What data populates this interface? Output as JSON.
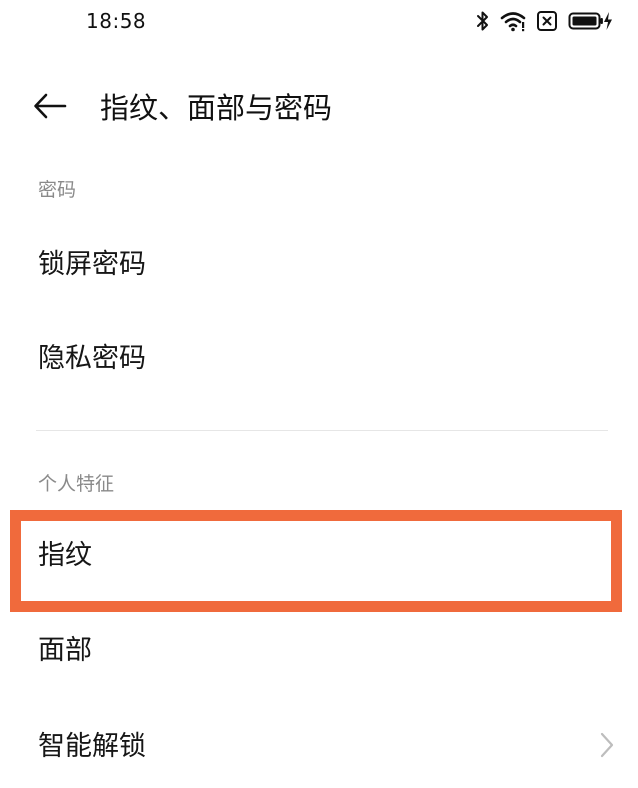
{
  "status_bar": {
    "time": "18:58",
    "icons": [
      "bluetooth-icon",
      "wifi-icon",
      "sim-error-icon",
      "battery-charging-icon"
    ]
  },
  "header": {
    "back_icon": "back-arrow-icon",
    "title": "指纹、面部与密码"
  },
  "sections": {
    "password": {
      "label": "密码",
      "items": [
        {
          "label": "锁屏密码"
        },
        {
          "label": "隐私密码"
        }
      ]
    },
    "biometrics": {
      "label": "个人特征",
      "items": [
        {
          "label": "指纹",
          "highlighted": true
        },
        {
          "label": "面部"
        },
        {
          "label": "智能解锁",
          "has_chevron": true
        }
      ]
    }
  },
  "colors": {
    "highlight_border": "#f06a3c",
    "section_label": "#8a8a8a",
    "text": "#161616",
    "divider": "#e6e6e6"
  }
}
